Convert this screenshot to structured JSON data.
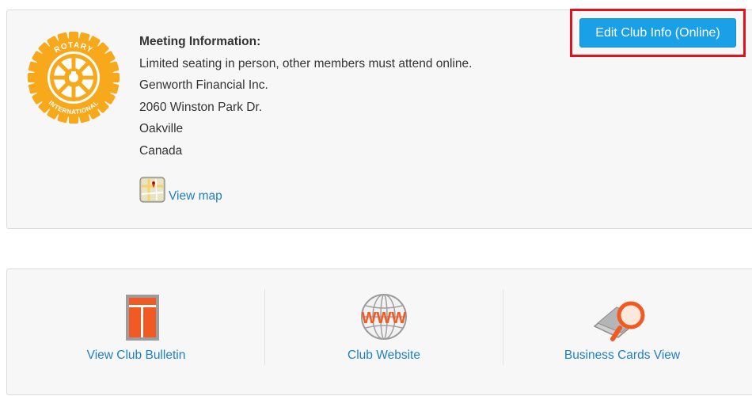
{
  "meeting": {
    "title": "Meeting Information:",
    "lines": [
      "Limited seating in person, other members must attend online.",
      "Genworth Financial Inc.",
      "2060 Winston Park Dr.",
      "Oakville",
      "Canada"
    ],
    "view_map_label": "View map"
  },
  "edit_button": {
    "label": "Edit Club Info (Online)"
  },
  "logo": {
    "text_top": "ROTARY",
    "text_bottom": "INTERNATIONAL"
  },
  "links": [
    {
      "label": "View Club Bulletin",
      "icon": "bulletin-icon"
    },
    {
      "label": "Club Website",
      "icon": "www-globe-icon",
      "icon_text": "WWW"
    },
    {
      "label": "Business Cards View",
      "icon": "business-cards-search-icon"
    }
  ],
  "colors": {
    "link": "#1f7fc4",
    "button": "#1aa0e6",
    "highlight": "#e0121b",
    "rotary_gold": "#f7a81b",
    "orange": "#f15a22"
  }
}
